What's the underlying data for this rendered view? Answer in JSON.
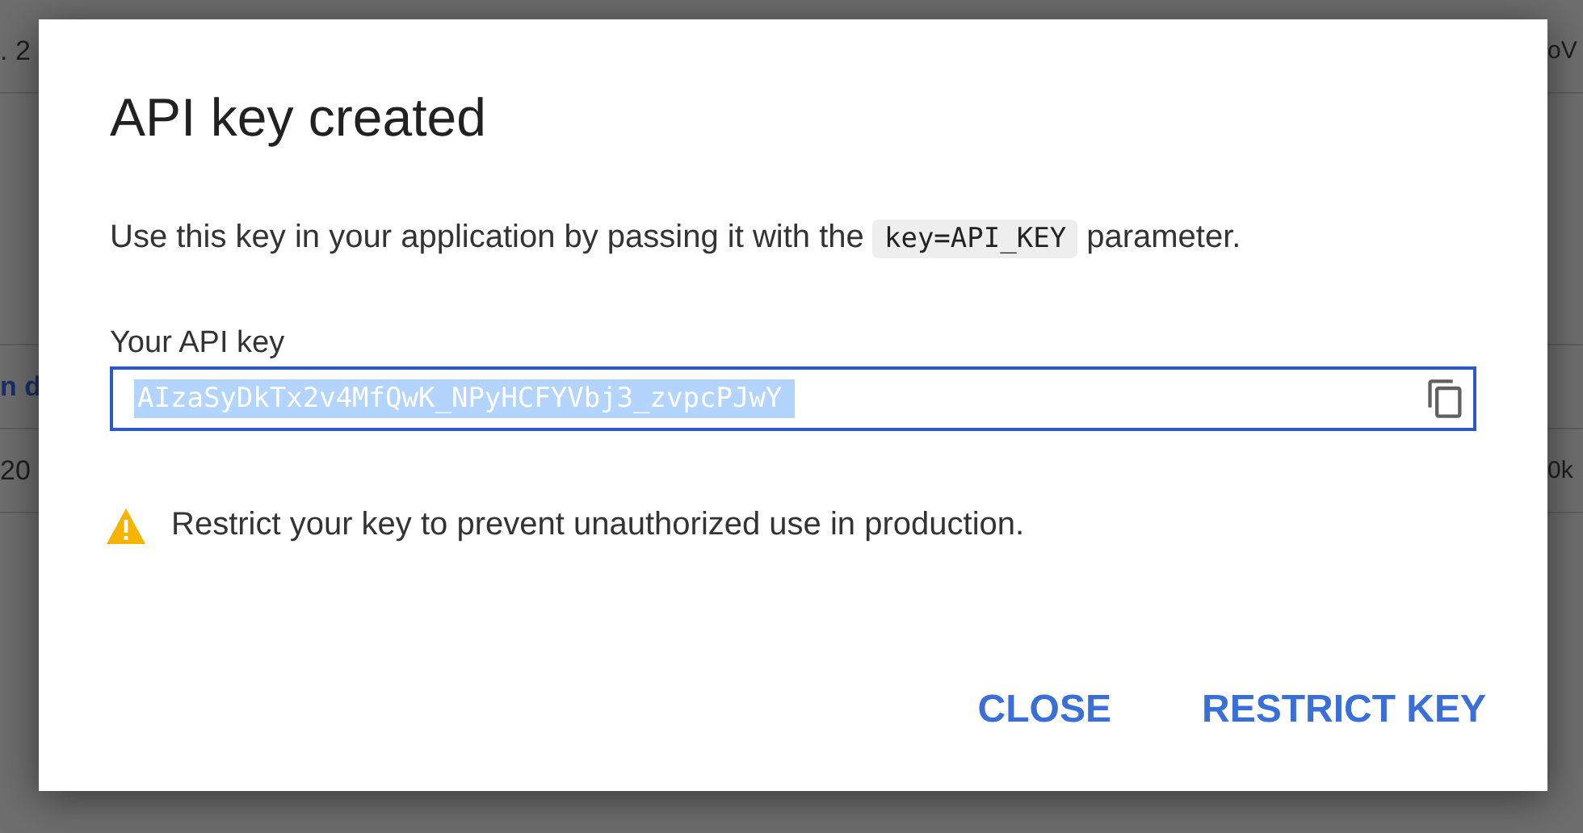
{
  "background": {
    "left_texts": [
      {
        "text": ". 2",
        "kind": "plain"
      },
      {
        "text": "n d",
        "kind": "link"
      },
      {
        "text": "20",
        "kind": "plain"
      }
    ],
    "right_texts": [
      {
        "text": "oV"
      },
      {
        "text": "0k"
      }
    ]
  },
  "dialog": {
    "title": "API key created",
    "description": {
      "before": "Use this key in your application by passing it with the ",
      "code": "key=API_KEY",
      "after": " parameter."
    },
    "field": {
      "label": "Your API key",
      "value": "AIzaSyDkTx2v4MfQwK_NPyHCFYVbj3_zvpcPJwY",
      "value_selected": true
    },
    "warning": "Restrict your key to prevent unauthorized use in production.",
    "buttons": [
      "CLOSE",
      "RESTRICT KEY"
    ]
  }
}
